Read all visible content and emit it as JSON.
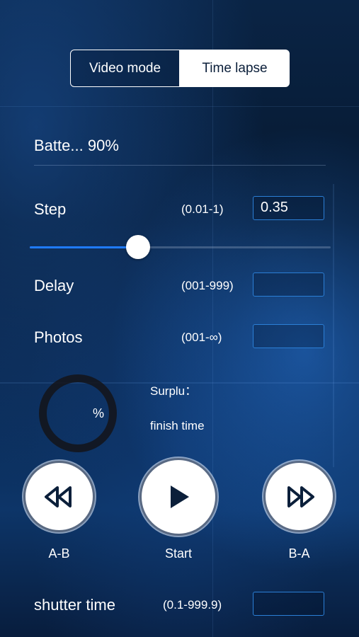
{
  "mode_switch": {
    "video_label": "Video mode",
    "timelapse_label": "Time lapse",
    "selected": "Time lapse"
  },
  "battery": {
    "label": "Batte...",
    "value": "90%"
  },
  "step": {
    "label": "Step",
    "range": "(0.01-1)",
    "value": "0.35",
    "slider_fraction": 0.36
  },
  "delay": {
    "label": "Delay",
    "range": "(001-999)",
    "value": ""
  },
  "photos": {
    "label": "Photos",
    "range": "(001-∞)",
    "value": ""
  },
  "progress": {
    "percent_label": "%",
    "surplus_label": "Surplu：",
    "finish_label": "finish time"
  },
  "controls": {
    "ab_label": "A-B",
    "start_label": "Start",
    "ba_label": "B-A"
  },
  "shutter": {
    "label": "shutter time",
    "range": "(0.1-999.9)",
    "value": ""
  },
  "colors": {
    "accent": "#1f7bff",
    "box_border": "#2b7fd6",
    "icon_dark": "#0b1f3a"
  }
}
